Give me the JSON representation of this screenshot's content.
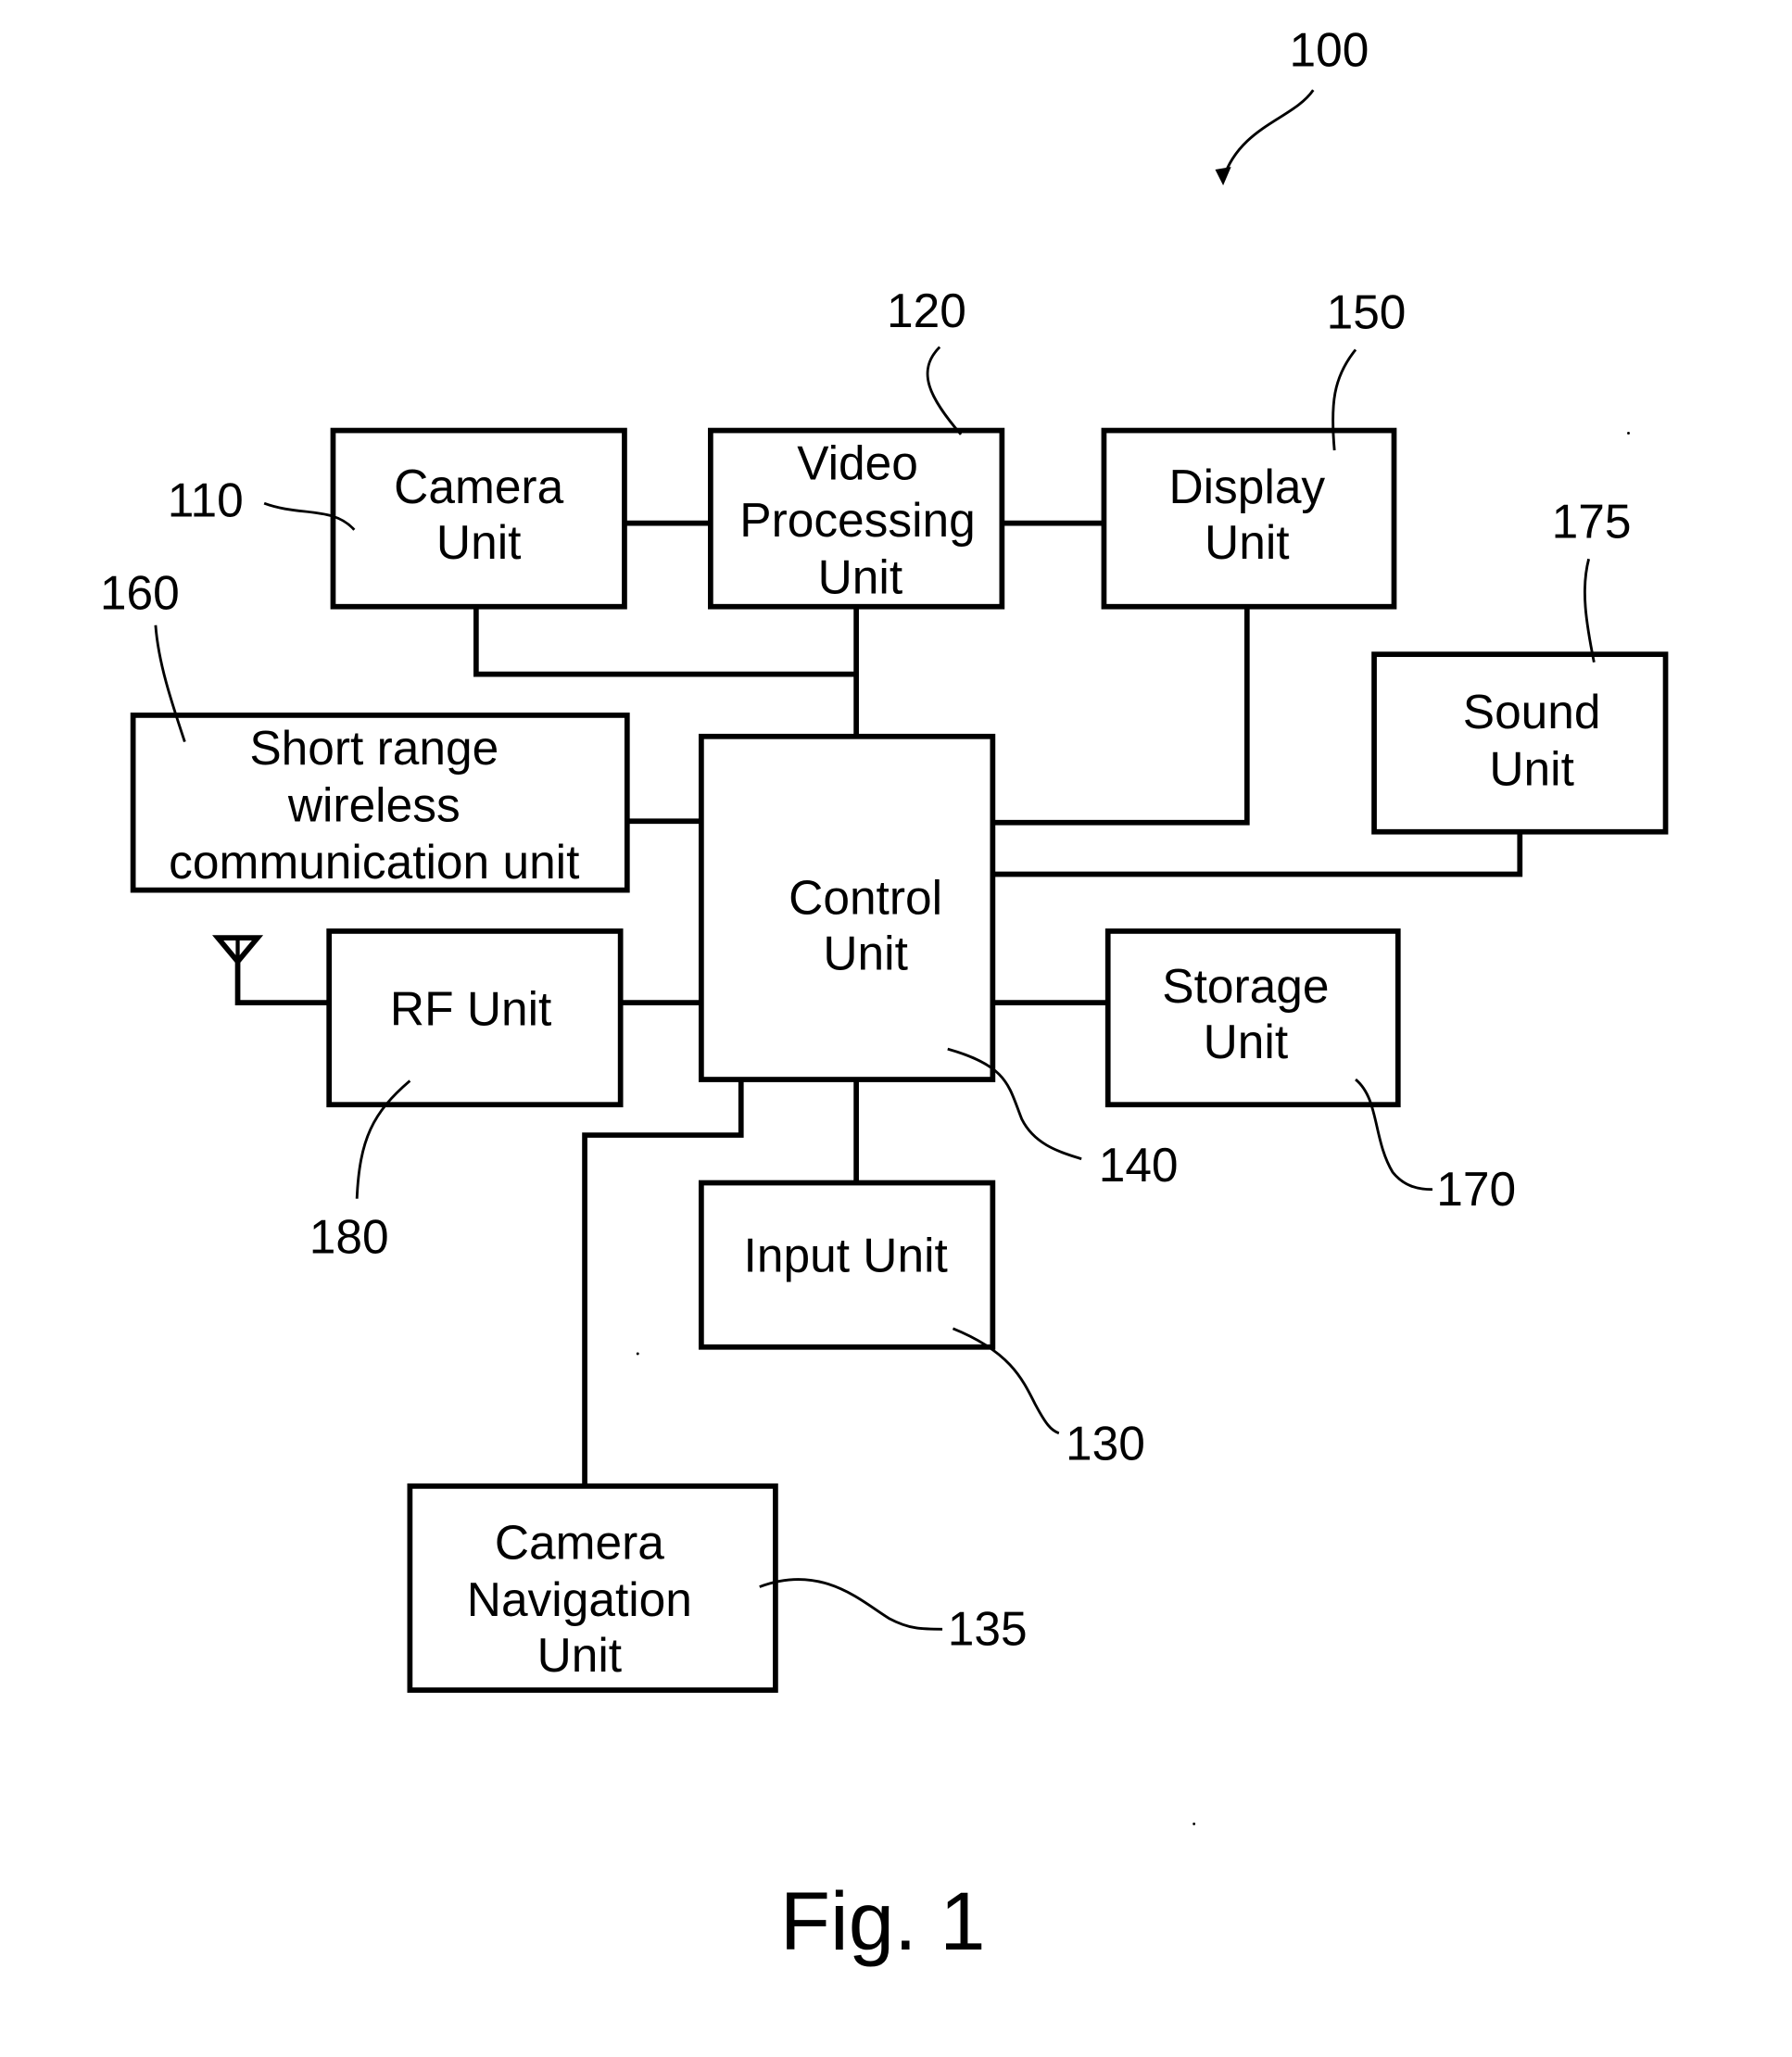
{
  "figure": {
    "reference": "100",
    "caption": "Fig. 1"
  },
  "blocks": {
    "camera_unit": {
      "ref": "110",
      "lines": [
        "Camera",
        "Unit"
      ]
    },
    "video_processing_unit": {
      "ref": "120",
      "lines": [
        "Video",
        "Processing",
        "Unit"
      ]
    },
    "display_unit": {
      "ref": "150",
      "lines": [
        "Display",
        "Unit"
      ]
    },
    "sound_unit": {
      "ref": "175",
      "lines": [
        "Sound",
        "Unit"
      ]
    },
    "short_range_wireless_unit": {
      "ref": "160",
      "lines": [
        "Short range",
        "wireless",
        "communication unit"
      ]
    },
    "control_unit": {
      "ref": "140",
      "lines": [
        "Control",
        "Unit"
      ]
    },
    "rf_unit": {
      "ref": "180",
      "lines": [
        "RF Unit"
      ]
    },
    "storage_unit": {
      "ref": "170",
      "lines": [
        "Storage",
        "Unit"
      ]
    },
    "input_unit": {
      "ref": "130",
      "lines": [
        "Input Unit"
      ]
    },
    "camera_navigation_unit": {
      "ref": "135",
      "lines": [
        "Camera",
        "Navigation",
        "Unit"
      ]
    }
  },
  "connections": [
    [
      "camera_unit",
      "video_processing_unit"
    ],
    [
      "video_processing_unit",
      "display_unit"
    ],
    [
      "camera_unit",
      "control_unit"
    ],
    [
      "video_processing_unit",
      "control_unit"
    ],
    [
      "display_unit",
      "control_unit"
    ],
    [
      "sound_unit",
      "control_unit"
    ],
    [
      "short_range_wireless_unit",
      "control_unit"
    ],
    [
      "rf_unit",
      "control_unit"
    ],
    [
      "storage_unit",
      "control_unit"
    ],
    [
      "input_unit",
      "control_unit"
    ],
    [
      "camera_navigation_unit",
      "control_unit"
    ],
    [
      "antenna",
      "rf_unit"
    ]
  ]
}
